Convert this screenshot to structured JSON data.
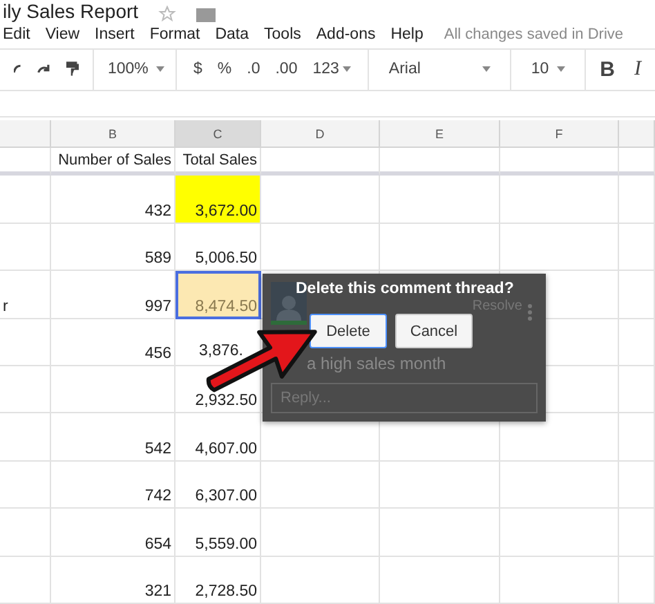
{
  "title": "ily Sales Report",
  "menu": [
    "Edit",
    "View",
    "Insert",
    "Format",
    "Data",
    "Tools",
    "Add-ons",
    "Help"
  ],
  "save_status": "All changes saved in Drive",
  "toolbar": {
    "zoom": "100%",
    "currency": "$",
    "percent": "%",
    "decrease_decimals": ".0",
    "increase_decimals": ".00",
    "more_formats": "123",
    "font": "Arial",
    "font_size": "10",
    "bold": "B",
    "italic": "I"
  },
  "columns": [
    {
      "label": "B",
      "selected": false
    },
    {
      "label": "C",
      "selected": true
    },
    {
      "label": "D",
      "selected": false
    },
    {
      "label": "E",
      "selected": false
    },
    {
      "label": "F",
      "selected": false
    }
  ],
  "header_row": {
    "number": "Number of Sales",
    "total": "Total Sales"
  },
  "rows": [
    {
      "number": "432",
      "total": "3,672.00",
      "color": "#ffff00",
      "selected": false
    },
    {
      "number": "589",
      "total": "5,006.50",
      "selected": false
    },
    {
      "col_a": "r",
      "number": "997",
      "total": "8,474.50",
      "color": "#fce8b2",
      "selected": true
    },
    {
      "number": "456",
      "total": "3,876.",
      "selected": false
    },
    {
      "total": "2,932.50",
      "selected": false
    },
    {
      "number": "542",
      "total": "4,607.00",
      "selected": false
    },
    {
      "number": "742",
      "total": "6,307.00",
      "selected": false
    },
    {
      "number": "654",
      "total": "5,559.00",
      "selected": false
    },
    {
      "number": "321",
      "total": "2,728.50",
      "selected": false
    }
  ],
  "comment": {
    "prompt": "Delete this comment thread?",
    "buttons": [
      {
        "label": "Delete",
        "selected": true
      },
      {
        "label": "Cancel",
        "selected": false
      }
    ],
    "resolve": "Resolve",
    "body": "a high sales month",
    "reply_placeholder": "Reply..."
  }
}
